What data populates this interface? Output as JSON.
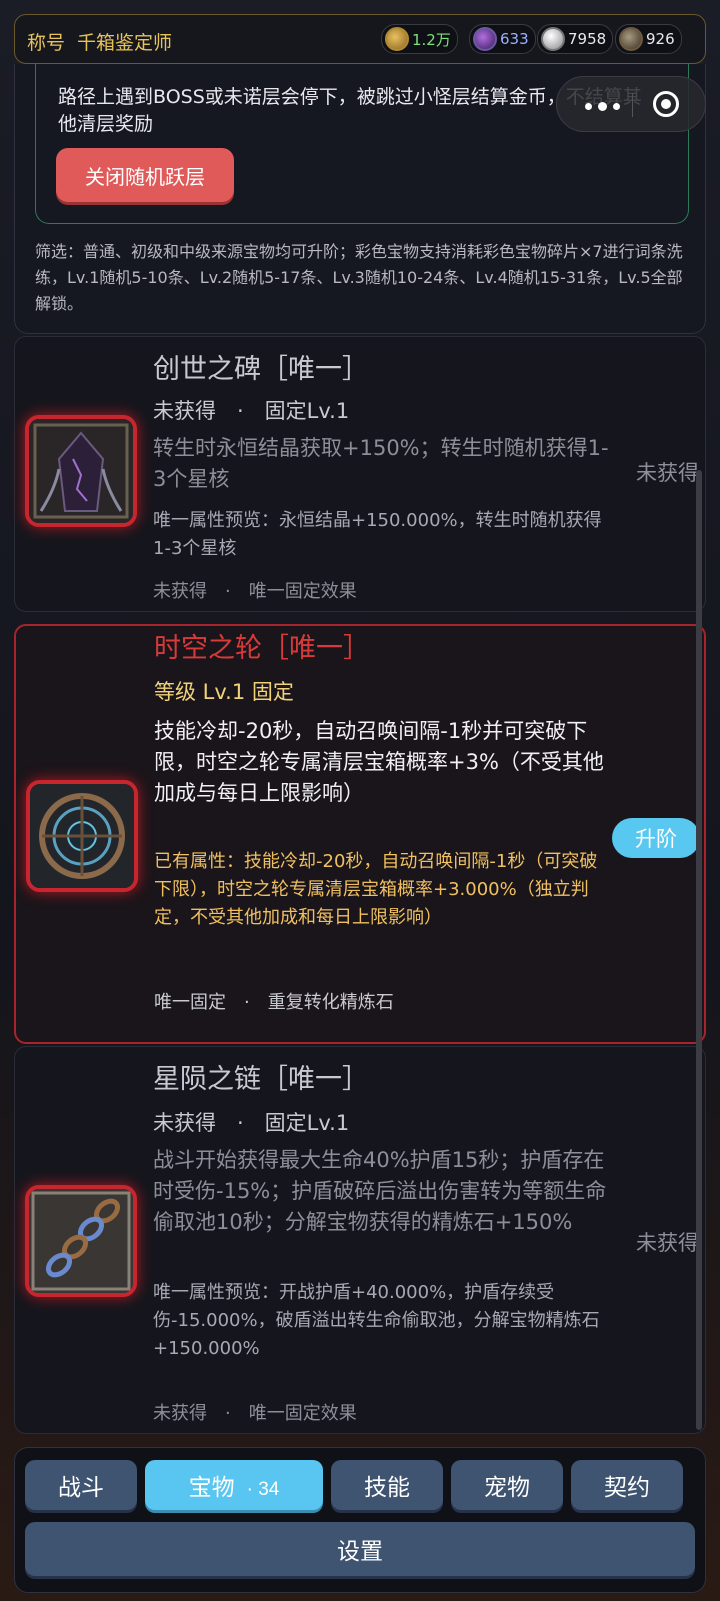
{
  "header": {
    "title_label": "称号",
    "title_value": "千箱鉴定师",
    "currencies": [
      {
        "icon": "gold-coin-icon",
        "value": "1.2万",
        "color": "#7ee07a"
      },
      {
        "icon": "purple-orb-icon",
        "value": "633",
        "color": "#9ab0ff"
      },
      {
        "icon": "crystal-drop-icon",
        "value": "7958",
        "color": "#e8e8ee"
      },
      {
        "icon": "stone-ore-icon",
        "value": "926",
        "color": "#e8e8ee"
      }
    ]
  },
  "info": {
    "jump_text": "路径上遇到BOSS或未诺层会停下，被跳过小怪层结算金币，不结算其他清层奖励",
    "jump_button": "关闭随机跃层",
    "filter_text": "筛选：普通、初级和中级来源宝物均可升阶；彩色宝物支持消耗彩色宝物碎片×7进行词条洗练，Lv.1随机5-10条、Lv.2随机5-17条、Lv.3随机10-24条、Lv.4随机15-31条，Lv.5全部解锁。"
  },
  "treasures": [
    {
      "name": "创世之碑［唯一］",
      "meta": "未获得　·　固定Lv.1",
      "desc": "转生时永恒结晶获取+150%；转生时随机获得1-3个星核",
      "preview": "唯一属性预览：永恒结晶+150.000%，转生时随机获得1-3个星核",
      "footer": "未获得　·　唯一固定效果",
      "status": "未获得"
    },
    {
      "name": "时空之轮［唯一］",
      "meta": "等级 Lv.1 固定",
      "desc": "技能冷却-20秒，自动召唤间隔-1秒并可突破下限，时空之轮专属清层宝箱概率+3%（不受其他加成与每日上限影响）",
      "preview": "已有属性：技能冷却-20秒，自动召唤间隔-1秒（可突破下限），时空之轮专属清层宝箱概率+3.000%（独立判定，不受其他加成和每日上限影响）",
      "footer": "唯一固定　·　重复转化精炼石",
      "action": "升阶"
    },
    {
      "name": "星陨之链［唯一］",
      "meta": "未获得　·　固定Lv.1",
      "desc": "战斗开始获得最大生命40%护盾15秒；护盾存在时受伤-15%；护盾破碎后溢出伤害转为等额生命偷取池10秒；分解宝物获得的精炼石+150%",
      "preview": "唯一属性预览：开战护盾+40.000%，护盾存续受伤-15.000%，破盾溢出转生命偷取池，分解宝物精炼石+150.000%",
      "footer": "未获得　·　唯一固定效果",
      "status": "未获得"
    }
  ],
  "tabs": {
    "items": [
      "战斗",
      "宝物",
      "技能",
      "宠物",
      "契约"
    ],
    "active_count": "· 34",
    "settings": "设置"
  }
}
